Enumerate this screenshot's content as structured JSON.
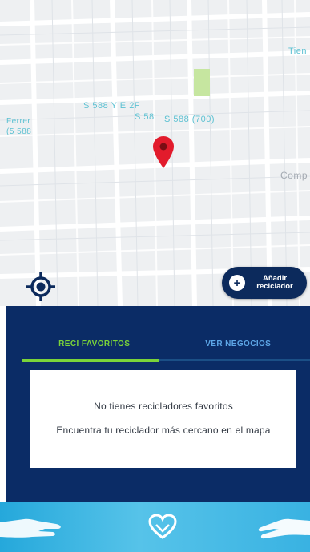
{
  "map": {
    "labels": {
      "street_1": "S 588 Y E 2F",
      "street_2": "S 588 (700)",
      "street_3": "S 58",
      "street_4": "Ferrer",
      "street_5": "(5 588",
      "place_top_right": "Tien",
      "place_right": "Comp"
    }
  },
  "buttons": {
    "add_recycler_line1": "Añadir",
    "add_recycler_line2": "reciclador"
  },
  "tabs": {
    "favorites": "RECI FAVORITOS",
    "businesses": "VER NEGOCIOS",
    "active": "favorites"
  },
  "empty_state": {
    "title": "No tienes recicladores favoritos",
    "message": "Encuentra tu reciclador más cercano en el mapa"
  },
  "colors": {
    "panel": "#0b2c66",
    "accent_green": "#7ad339",
    "pin_red": "#e21b2c",
    "nav_blue": "#39b2e2"
  },
  "icons": {
    "locate": "crosshair-icon",
    "add": "plus-circle-icon",
    "nav_left": "hand-icon",
    "nav_mid": "heart-icon",
    "nav_right": "hand-icon"
  }
}
